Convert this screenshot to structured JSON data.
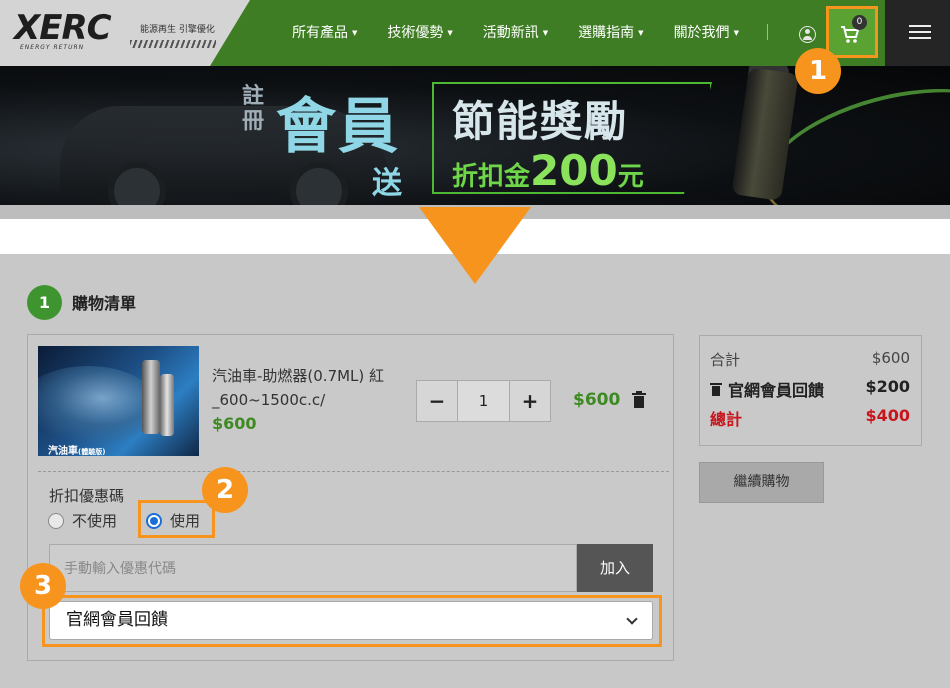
{
  "nav": {
    "logo_text": "XERC",
    "logo_sub": "ENERGY RETURN",
    "slogan": "能源再生 引擎優化",
    "menu": [
      "所有產品",
      "技術優勢",
      "活動新訊",
      "選購指南",
      "關於我們"
    ],
    "cart_count": "0"
  },
  "banner": {
    "register": "註冊",
    "member": "會員",
    "send": "送",
    "title": "節能獎勵",
    "discount_prefix": "折扣金",
    "discount_amount": "200",
    "discount_suffix": "元"
  },
  "steps": {
    "num": "1",
    "title": "購物清單"
  },
  "product": {
    "image_label": "汽油車",
    "image_label_small": "(體驗版)",
    "name": "汽油車-助燃器(0.7ML) 紅_600~1500c.c/",
    "price": "$600",
    "qty": "1",
    "minus": "−",
    "plus": "+",
    "line_total": "$600"
  },
  "discount": {
    "label": "折扣優惠碼",
    "option_no": "不使用",
    "option_yes": "使用",
    "selected": "使用",
    "input_placeholder": "手動輸入優惠代碼",
    "add_label": "加入",
    "select_value": "官網會員回饋"
  },
  "summary": {
    "subtotal_label": "合計",
    "subtotal": "$600",
    "reward_label": "官網會員回饋",
    "reward": "$200",
    "total_label": "總計",
    "total": "$400"
  },
  "continue_label": "繼續購物",
  "badges": [
    "1",
    "2",
    "3"
  ],
  "colors": {
    "accent": "#f7941d",
    "brand_green": "#3e7d23",
    "price_green": "#3e8a22",
    "total_red": "#c8141b",
    "radio_blue": "#1a6fd6"
  }
}
